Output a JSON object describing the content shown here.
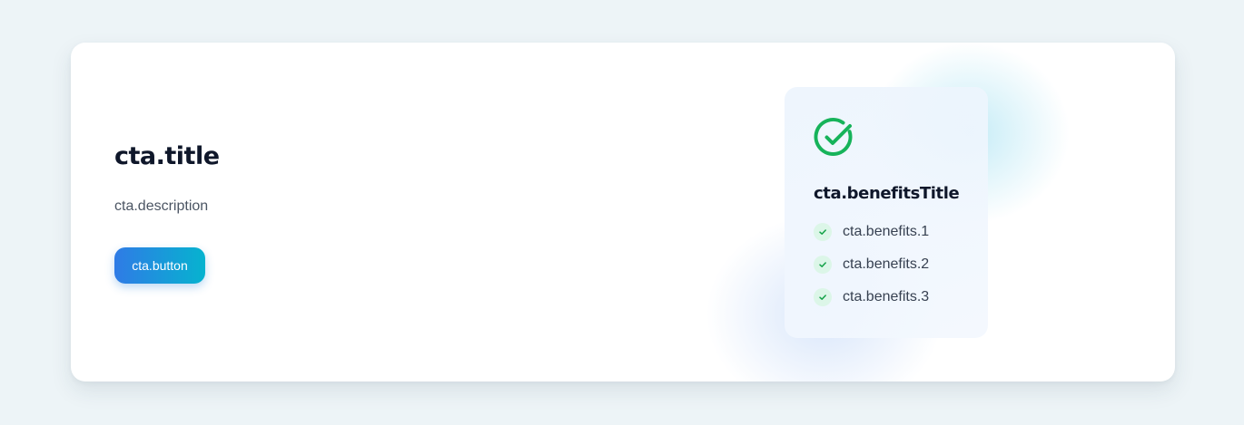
{
  "cta": {
    "title": "cta.title",
    "description": "cta.description",
    "button": "cta.button",
    "benefitsTitle": "cta.benefitsTitle",
    "benefits": [
      "cta.benefits.1",
      "cta.benefits.2",
      "cta.benefits.3"
    ]
  },
  "icons": {
    "header_icon": "check-circle-icon",
    "item_icon": "check-icon"
  },
  "colors": {
    "page_background": "#edf4f7",
    "button_gradient_start": "#2f7be6",
    "button_gradient_end": "#06b3cf",
    "success_green": "#16b35a",
    "title_text": "#0f172a"
  }
}
